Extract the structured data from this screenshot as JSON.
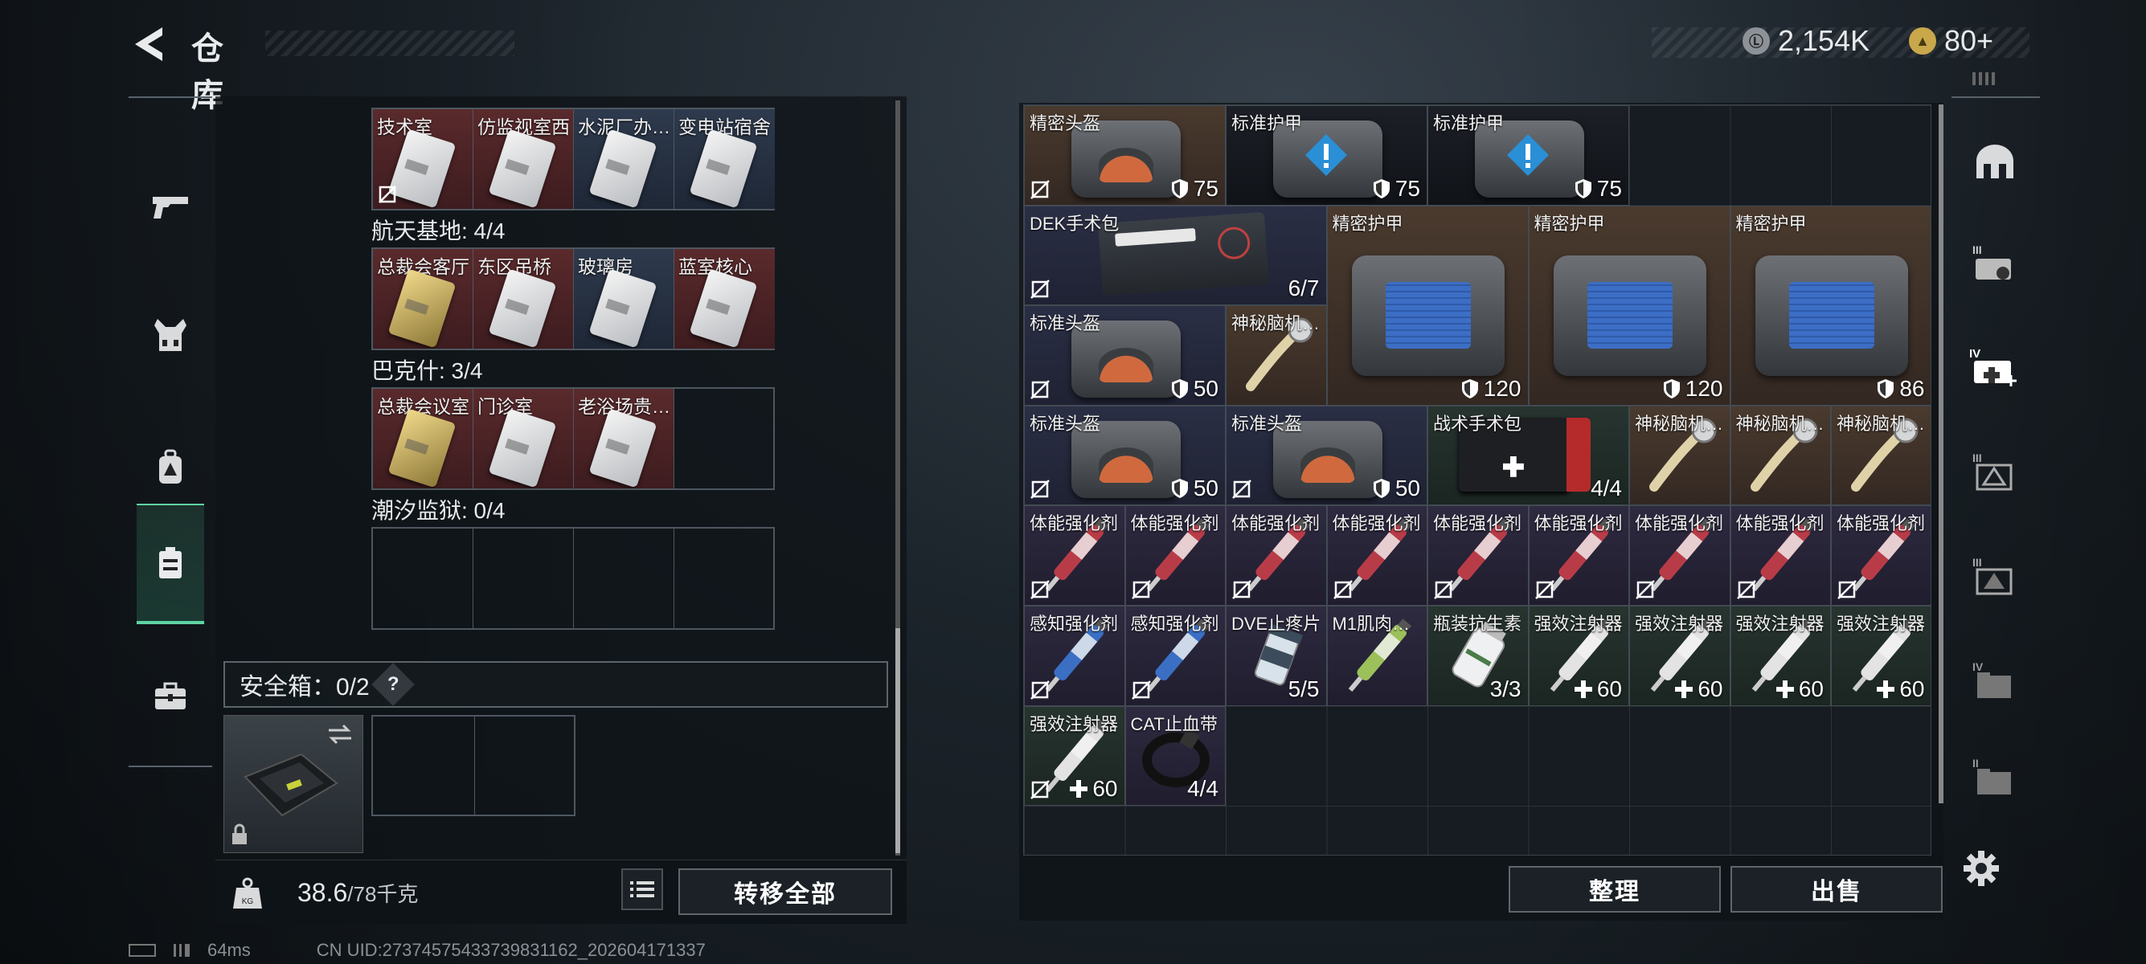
{
  "header": {
    "title": "仓库",
    "currency_value": "2,154K",
    "token_value": "80+",
    "currency_coin": "Ⓛ",
    "token_coin": "▲"
  },
  "left_nav": [
    "pistol-icon",
    "vest-icon",
    "backpack-icon",
    "case-icon",
    "toolbox-icon"
  ],
  "keycard_groups": [
    {
      "label": "",
      "cards": [
        {
          "name": "技术室",
          "bg": "red"
        },
        {
          "name": "仿监视室西",
          "bg": "red"
        },
        {
          "name": "水泥厂办…",
          "bg": "blu"
        },
        {
          "name": "变电站宿舍",
          "bg": "blu"
        }
      ]
    },
    {
      "label": "航天基地: 4/4",
      "cards": [
        {
          "name": "总裁会客厅",
          "bg": "red"
        },
        {
          "name": "东区吊桥",
          "bg": "red"
        },
        {
          "name": "玻璃房",
          "bg": "blu"
        },
        {
          "name": "蓝室核心",
          "bg": "red"
        }
      ]
    },
    {
      "label": "巴克什: 3/4",
      "cards": [
        {
          "name": "总裁会议室",
          "bg": "red"
        },
        {
          "name": "门诊室",
          "bg": "red"
        },
        {
          "name": "老浴场贵…",
          "bg": "red"
        },
        {
          "name": "",
          "bg": ""
        }
      ]
    },
    {
      "label": "潮汐监狱: 0/4",
      "cards": [
        {
          "name": "",
          "bg": ""
        },
        {
          "name": "",
          "bg": ""
        },
        {
          "name": "",
          "bg": ""
        },
        {
          "name": "",
          "bg": ""
        }
      ]
    }
  ],
  "safe_box": {
    "label": "安全箱：0/2",
    "help": "?"
  },
  "weight": {
    "current": "38.6",
    "max": "/78千克",
    "unit_icon": "KG"
  },
  "buttons": {
    "transfer_all": "转移全部",
    "organize": "整理",
    "sell": "出售"
  },
  "inventory": [
    {
      "name": "精密头盔",
      "value": "75",
      "type": "helmet",
      "bg": "brn",
      "r": 0,
      "c": 0,
      "w": 2,
      "h": 1,
      "icon": "shield"
    },
    {
      "name": "标准护甲",
      "value": "75",
      "type": "armor-warn",
      "bg": "dk",
      "r": 0,
      "c": 2,
      "w": 2,
      "h": 1,
      "icon": "shield"
    },
    {
      "name": "标准护甲",
      "value": "75",
      "type": "armor-warn",
      "bg": "dk",
      "r": 0,
      "c": 4,
      "w": 2,
      "h": 1,
      "icon": "shield"
    },
    {
      "name": "DEK手术包",
      "value": "6/7",
      "type": "medkit-bag",
      "bg": "nav",
      "r": 1,
      "c": 0,
      "w": 3,
      "h": 1,
      "icon": ""
    },
    {
      "name": "精密护甲",
      "value": "120",
      "type": "armor",
      "bg": "brn",
      "r": 1,
      "c": 3,
      "w": 2,
      "h": 2,
      "icon": "shield"
    },
    {
      "name": "精密护甲",
      "value": "120",
      "type": "armor",
      "bg": "brn",
      "r": 1,
      "c": 5,
      "w": 2,
      "h": 2,
      "icon": "shield"
    },
    {
      "name": "精密护甲",
      "value": "86",
      "type": "armor",
      "bg": "brn",
      "r": 1,
      "c": 7,
      "w": 2,
      "h": 2,
      "icon": "shield"
    },
    {
      "name": "标准头盔",
      "value": "50",
      "type": "helmet",
      "bg": "nav",
      "r": 2,
      "c": 0,
      "w": 2,
      "h": 1,
      "icon": "shield"
    },
    {
      "name": "神秘脑机…",
      "value": "",
      "type": "cable",
      "bg": "brn",
      "r": 2,
      "c": 2,
      "w": 1,
      "h": 1,
      "icon": ""
    },
    {
      "name": "标准头盔",
      "value": "50",
      "type": "helmet",
      "bg": "nav",
      "r": 3,
      "c": 0,
      "w": 2,
      "h": 1,
      "icon": "shield"
    },
    {
      "name": "标准头盔",
      "value": "50",
      "type": "helmet",
      "bg": "nav",
      "r": 3,
      "c": 2,
      "w": 2,
      "h": 1,
      "icon": "shield"
    },
    {
      "name": "战术手术包",
      "value": "4/4",
      "type": "firstaid",
      "bg": "grn",
      "r": 3,
      "c": 4,
      "w": 2,
      "h": 1,
      "icon": ""
    },
    {
      "name": "神秘脑机…",
      "value": "",
      "type": "cable",
      "bg": "brn",
      "r": 3,
      "c": 6,
      "w": 1,
      "h": 1,
      "icon": ""
    },
    {
      "name": "神秘脑机…",
      "value": "",
      "type": "cable",
      "bg": "brn",
      "r": 3,
      "c": 7,
      "w": 1,
      "h": 1,
      "icon": ""
    },
    {
      "name": "神秘脑机…",
      "value": "",
      "type": "cable",
      "bg": "brn",
      "r": 3,
      "c": 8,
      "w": 1,
      "h": 1,
      "icon": ""
    },
    {
      "name": "体能强化剂",
      "value": "",
      "type": "syringe-red",
      "bg": "pur",
      "r": 4,
      "c": 0,
      "w": 1,
      "h": 1,
      "icon": ""
    },
    {
      "name": "体能强化剂",
      "value": "",
      "type": "syringe-red",
      "bg": "pur",
      "r": 4,
      "c": 1,
      "w": 1,
      "h": 1,
      "icon": ""
    },
    {
      "name": "体能强化剂",
      "value": "",
      "type": "syringe-red",
      "bg": "pur",
      "r": 4,
      "c": 2,
      "w": 1,
      "h": 1,
      "icon": ""
    },
    {
      "name": "体能强化剂",
      "value": "",
      "type": "syringe-red",
      "bg": "pur",
      "r": 4,
      "c": 3,
      "w": 1,
      "h": 1,
      "icon": ""
    },
    {
      "name": "体能强化剂",
      "value": "",
      "type": "syringe-red",
      "bg": "pur",
      "r": 4,
      "c": 4,
      "w": 1,
      "h": 1,
      "icon": ""
    },
    {
      "name": "体能强化剂",
      "value": "",
      "type": "syringe-red",
      "bg": "pur",
      "r": 4,
      "c": 5,
      "w": 1,
      "h": 1,
      "icon": ""
    },
    {
      "name": "体能强化剂",
      "value": "",
      "type": "syringe-red",
      "bg": "pur",
      "r": 4,
      "c": 6,
      "w": 1,
      "h": 1,
      "icon": ""
    },
    {
      "name": "体能强化剂",
      "value": "",
      "type": "syringe-red",
      "bg": "pur",
      "r": 4,
      "c": 7,
      "w": 1,
      "h": 1,
      "icon": ""
    },
    {
      "name": "体能强化剂",
      "value": "",
      "type": "syringe-red",
      "bg": "pur",
      "r": 4,
      "c": 8,
      "w": 1,
      "h": 1,
      "icon": ""
    },
    {
      "name": "感知强化剂",
      "value": "",
      "type": "syringe-blue",
      "bg": "pur",
      "r": 5,
      "c": 0,
      "w": 1,
      "h": 1,
      "icon": ""
    },
    {
      "name": "感知强化剂",
      "value": "",
      "type": "syringe-blue",
      "bg": "pur",
      "r": 5,
      "c": 1,
      "w": 1,
      "h": 1,
      "icon": ""
    },
    {
      "name": "DVE止疼片",
      "value": "5/5",
      "type": "pills",
      "bg": "pur",
      "r": 5,
      "c": 2,
      "w": 1,
      "h": 1,
      "icon": ""
    },
    {
      "name": "M1肌肉…",
      "value": "",
      "type": "syringe-green",
      "bg": "pur",
      "r": 5,
      "c": 3,
      "w": 1,
      "h": 1,
      "icon": ""
    },
    {
      "name": "瓶装抗生素",
      "value": "3/3",
      "type": "bottle",
      "bg": "grn",
      "r": 5,
      "c": 4,
      "w": 1,
      "h": 1,
      "icon": ""
    },
    {
      "name": "强效注射器",
      "value": "60",
      "type": "syringe-white",
      "bg": "grn",
      "r": 5,
      "c": 5,
      "w": 1,
      "h": 1,
      "icon": "plus"
    },
    {
      "name": "强效注射器",
      "value": "60",
      "type": "syringe-white",
      "bg": "grn",
      "r": 5,
      "c": 6,
      "w": 1,
      "h": 1,
      "icon": "plus"
    },
    {
      "name": "强效注射器",
      "value": "60",
      "type": "syringe-white",
      "bg": "grn",
      "r": 5,
      "c": 7,
      "w": 1,
      "h": 1,
      "icon": "plus"
    },
    {
      "name": "强效注射器",
      "value": "60",
      "type": "syringe-white",
      "bg": "grn",
      "r": 5,
      "c": 8,
      "w": 1,
      "h": 1,
      "icon": "plus"
    },
    {
      "name": "强效注射器",
      "value": "60",
      "type": "syringe-white",
      "bg": "grn",
      "r": 6,
      "c": 0,
      "w": 1,
      "h": 1,
      "icon": "plus"
    },
    {
      "name": "CAT止血带",
      "value": "4/4",
      "type": "tourniquet",
      "bg": "pur",
      "r": 6,
      "c": 1,
      "w": 1,
      "h": 1,
      "icon": ""
    }
  ],
  "nosell_items": [
    0,
    3,
    7,
    9,
    10,
    15,
    16,
    17,
    18,
    19,
    20,
    21,
    22,
    23,
    24,
    25,
    33
  ],
  "right_nav": [
    "helmet-icon",
    "III-armor-icon",
    "IV-medical-icon",
    "III-case-icon",
    "III-pack-icon",
    "IV-folder-icon",
    "II-folder-icon"
  ],
  "status": {
    "latency": "64ms",
    "uid": "CN UID:27374575433739831162_202604171337"
  }
}
